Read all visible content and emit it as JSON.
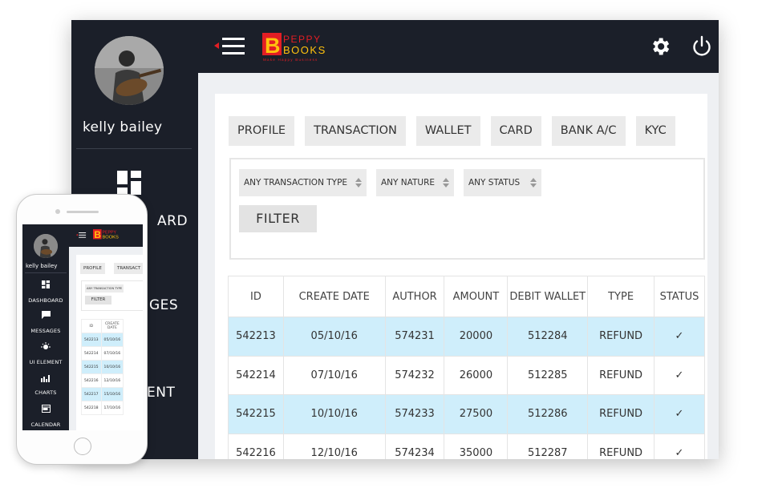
{
  "brand": {
    "letter": "B",
    "line1": "PEPPY",
    "line2": "BOOKS",
    "tagline": "Make Happy Business",
    "accent_red": "#e31e24",
    "accent_yellow": "#ffc20e"
  },
  "user": {
    "name": "kelly bailey"
  },
  "sidebar": {
    "items": [
      {
        "label": "DASHBOARD",
        "icon": "dashboard-icon",
        "visible_text": "ARD"
      },
      {
        "label": "MESSAGES",
        "icon": "messages-icon",
        "visible_text": "GES"
      },
      {
        "label": "UI ELEMENT",
        "icon": "ui-element-icon",
        "visible_text": "ENT"
      },
      {
        "label": "CHARTS",
        "icon": "charts-icon"
      },
      {
        "label": "CALENDAR",
        "icon": "calendar-icon"
      }
    ]
  },
  "tabs": [
    "PROFILE",
    "TRANSACTION",
    "WALLET",
    "CARD",
    "BANK A/C",
    "KYC"
  ],
  "filters": {
    "selects": [
      "ANY TRANSACTION TYPE",
      "ANY NATURE",
      "ANY STATUS"
    ],
    "button": "FILTER"
  },
  "table": {
    "columns": [
      "ID",
      "CREATE DATE",
      "AUTHOR",
      "AMOUNT",
      "DEBIT WALLET",
      "TYPE",
      "STATUS"
    ],
    "rows": [
      {
        "id": "542213",
        "date": "05/10/16",
        "author": "574231",
        "amount": "20000",
        "wallet": "512284",
        "type": "REFUND",
        "status": "✓",
        "highlight": true
      },
      {
        "id": "542214",
        "date": "07/10/16",
        "author": "574232",
        "amount": "26000",
        "wallet": "512285",
        "type": "REFUND",
        "status": "✓",
        "highlight": false
      },
      {
        "id": "542215",
        "date": "10/10/16",
        "author": "574233",
        "amount": "27500",
        "wallet": "512286",
        "type": "REFUND",
        "status": "✓",
        "highlight": true
      },
      {
        "id": "542216",
        "date": "12/10/16",
        "author": "574234",
        "amount": "35000",
        "wallet": "512287",
        "type": "REFUND",
        "status": "✓",
        "highlight": false
      }
    ]
  },
  "mobile": {
    "tabs": [
      "PROFILE",
      "TRANSACT"
    ],
    "select": "ANY TRANSACTION TYPE",
    "button": "FILTER",
    "columns": [
      "ID",
      "CREATE DATE"
    ],
    "rows": [
      {
        "id": "542213",
        "date": "05/10/16",
        "highlight": true
      },
      {
        "id": "542214",
        "date": "07/10/16",
        "highlight": false
      },
      {
        "id": "542215",
        "date": "10/10/16",
        "highlight": true
      },
      {
        "id": "542216",
        "date": "12/10/16",
        "highlight": false
      },
      {
        "id": "542217",
        "date": "15/10/16",
        "highlight": true
      },
      {
        "id": "542218",
        "date": "17/10/16",
        "highlight": false
      }
    ]
  }
}
